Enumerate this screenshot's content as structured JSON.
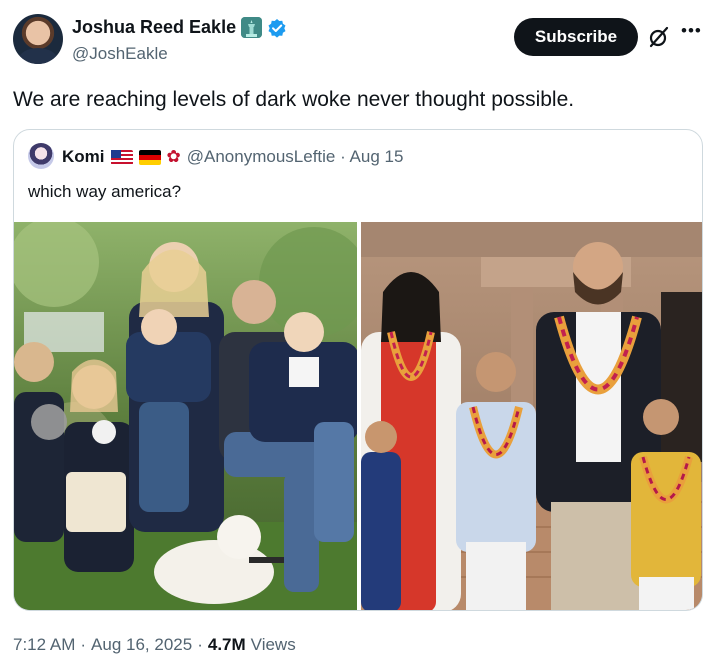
{
  "author": {
    "display_name": "Joshua Reed Eakle",
    "handle": "@JoshEakle",
    "avatar_icon": "profile-photo",
    "badges": [
      "statue-of-liberty-icon",
      "verified-badge-icon"
    ],
    "verified_color": "#1d9bf0"
  },
  "actions": {
    "subscribe_label": "Subscribe",
    "grok_icon": "grok-icon",
    "more_icon": "more-icon"
  },
  "tweet": {
    "text": "We are reaching levels of dark woke never thought possible."
  },
  "quoted_tweet": {
    "display_name": "Komi",
    "emoji_badges": [
      "us-flag",
      "germany-flag",
      "rose"
    ],
    "handle_date": "@AnonymousLeftie · Aug 15",
    "text": "which way america?",
    "images": [
      "family-photo-left",
      "family-photo-right"
    ]
  },
  "footer": {
    "time": "7:12 AM",
    "sep1": "·",
    "date": "Aug 16, 2025",
    "sep2": "·",
    "views_count": "4.7M",
    "views_label": "Views"
  }
}
